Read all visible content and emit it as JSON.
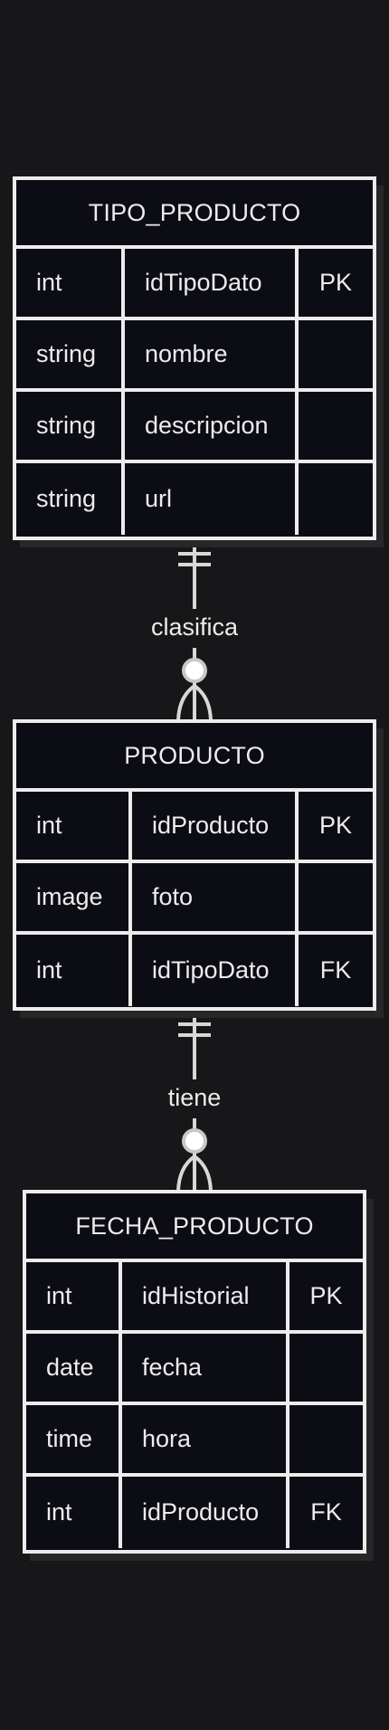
{
  "entities": [
    {
      "title": "TIPO_PRODUCTO",
      "attributes": [
        {
          "type": "int",
          "name": "idTipoDato",
          "key": "PK"
        },
        {
          "type": "string",
          "name": "nombre",
          "key": ""
        },
        {
          "type": "string",
          "name": "descripcion",
          "key": ""
        },
        {
          "type": "string",
          "name": "url",
          "key": ""
        }
      ]
    },
    {
      "title": "PRODUCTO",
      "attributes": [
        {
          "type": "int",
          "name": "idProducto",
          "key": "PK"
        },
        {
          "type": "image",
          "name": "foto",
          "key": ""
        },
        {
          "type": "int",
          "name": "idTipoDato",
          "key": "FK"
        }
      ]
    },
    {
      "title": "FECHA_PRODUCTO",
      "attributes": [
        {
          "type": "int",
          "name": "idHistorial",
          "key": "PK"
        },
        {
          "type": "date",
          "name": "fecha",
          "key": ""
        },
        {
          "type": "time",
          "name": "hora",
          "key": ""
        },
        {
          "type": "int",
          "name": "idProducto",
          "key": "FK"
        }
      ]
    }
  ],
  "relationships": [
    {
      "label": "clasifica",
      "from": "TIPO_PRODUCTO",
      "to": "PRODUCTO",
      "from_cardinality": "exactly-one",
      "to_cardinality": "zero-or-many"
    },
    {
      "label": "tiene",
      "from": "PRODUCTO",
      "to": "FECHA_PRODUCTO",
      "from_cardinality": "exactly-one",
      "to_cardinality": "zero-or-many"
    }
  ]
}
